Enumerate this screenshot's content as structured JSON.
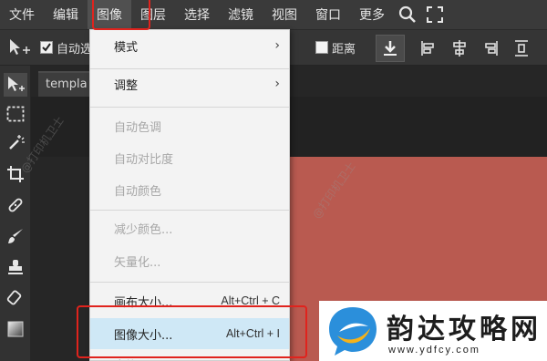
{
  "menubar": {
    "items": [
      "文件",
      "编辑",
      "图像",
      "图层",
      "选择",
      "滤镜",
      "视图",
      "窗口",
      "更多"
    ],
    "active": "图像"
  },
  "optbar": {
    "auto_select_label": "自动选",
    "distance_label": "距离"
  },
  "document": {
    "tab_title": "templa"
  },
  "colors": {
    "canvas_red": "#b95a50",
    "annotation_red": "#e0231d",
    "highlight": "#cfe8f6"
  },
  "image_menu": {
    "mode": "模式",
    "adjust": "调整",
    "auto_tone": "自动色调",
    "auto_contrast": "自动对比度",
    "auto_color": "自动颜色",
    "reduce_colors": "减少颜色...",
    "vectorize": "矢量化...",
    "canvas_size": "画布大小...",
    "canvas_size_shortcut": "Alt+Ctrl + C",
    "image_size": "图像大小...",
    "image_size_shortcut": "Alt+Ctrl + I",
    "next_partial": "变换"
  },
  "watermark": "@打印机卫士",
  "logo": {
    "title": "韵达攻略网",
    "url": "www.ydfcy.com"
  }
}
